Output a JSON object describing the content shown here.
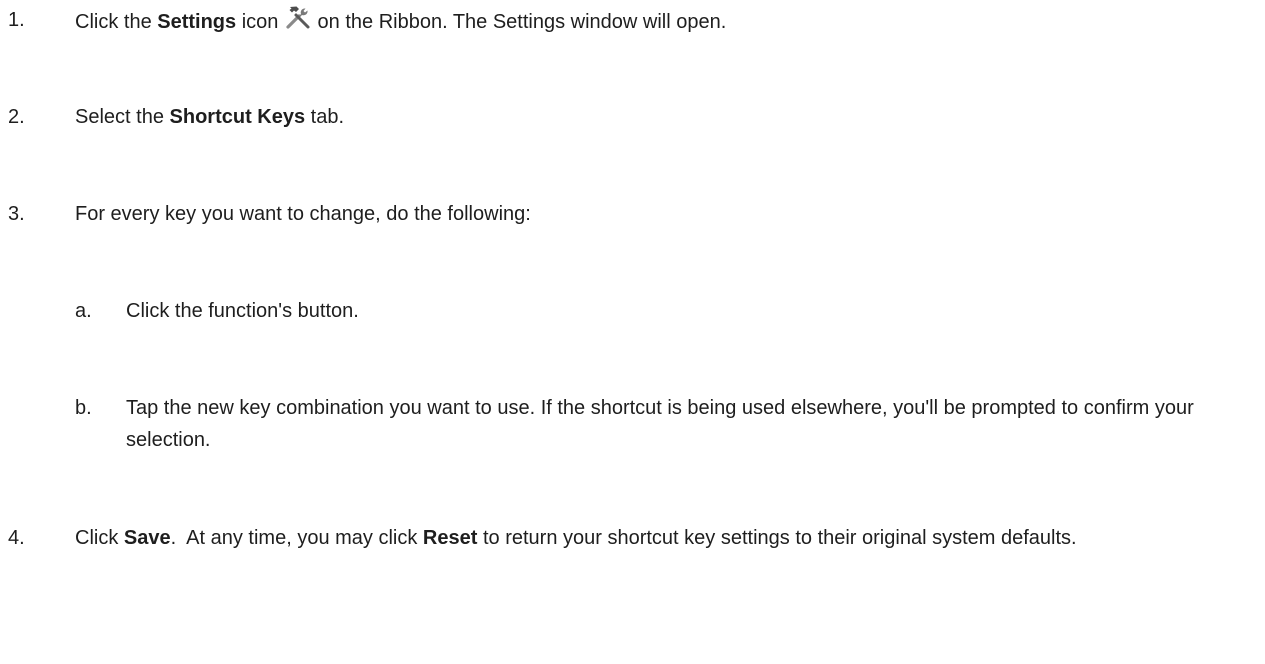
{
  "steps": [
    {
      "number": "1.",
      "before": "Click the ",
      "bold": "Settings",
      "middle": " icon ",
      "icon": "hammer-wrench-icon",
      "after": " on the Ribbon. The Settings window will open."
    },
    {
      "number": "2.",
      "before": "Select the ",
      "bold": "Shortcut Keys",
      "after": " tab."
    },
    {
      "number": "3.",
      "text": "For every key you want to change, do the following:"
    },
    {
      "number": "4.",
      "before": "Click ",
      "bold": "Save",
      "middle": ".  At any time, you may click ",
      "bold2": "Reset",
      "after": " to return your shortcut key settings to their original system defaults."
    }
  ],
  "substeps": [
    {
      "letter": "a.",
      "text": "Click the function's button."
    },
    {
      "letter": "b.",
      "text": "Tap the new key combination you want to use. If the shortcut is being used elsewhere, you'll be prompted to confirm your selection."
    }
  ]
}
